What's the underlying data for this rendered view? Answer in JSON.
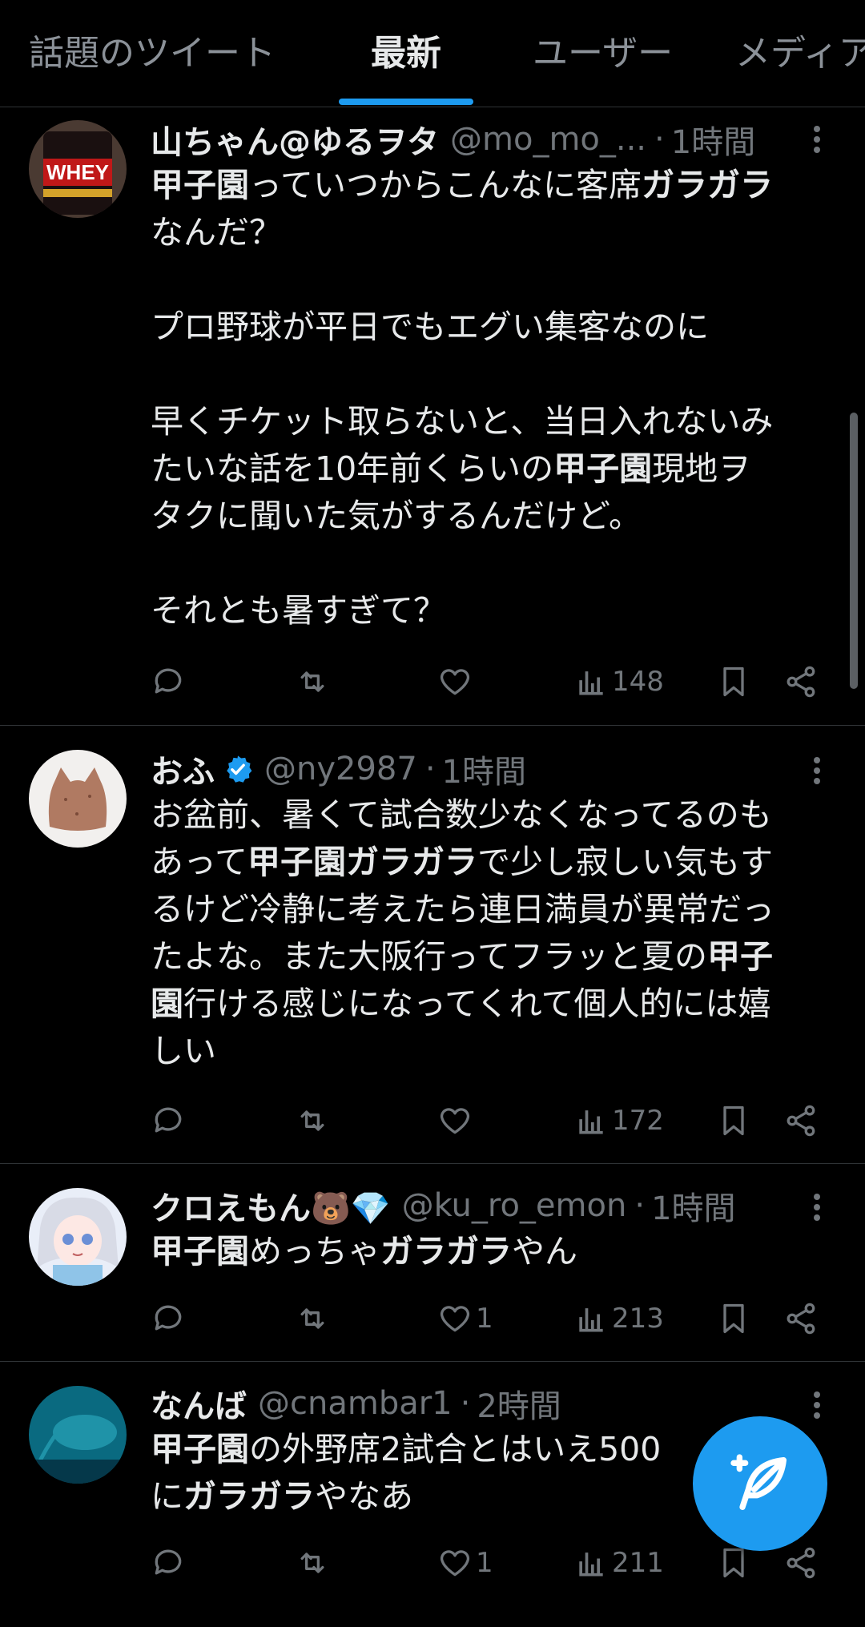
{
  "tabs": [
    {
      "label": "話題のツイート"
    },
    {
      "label": "最新"
    },
    {
      "label": "ユーザー"
    },
    {
      "label": "メディア"
    }
  ],
  "active_tab": "最新",
  "colors": {
    "accent": "#1d9bf0",
    "background": "#000000",
    "text": "#e7e9ea",
    "muted": "#71767b",
    "divider": "#2f3336"
  },
  "tweets": [
    {
      "name": "山ちゃん@ゆるヲタ",
      "handle": "@mo_mo_...",
      "time": "1時間",
      "body_html": "<b>甲子園</b>っていつからこんなに客席<b>ガラガラ</b>\nなんだ？\n\nプロ野球が平日でもエグい集客なのに\n\n早くチケット取らないと、当日入れないみ\nたいな話を10年前くらいの<b>甲子園</b>現地ヲ\nタクに聞いた気がするんだけど。\n\nそれとも暑すぎて？",
      "likes": "",
      "views": "148",
      "avatar_icon": "whey-protein-avatar"
    },
    {
      "name": "おふ",
      "handle": "@ny2987",
      "time": "1時間",
      "verified": true,
      "body_html": "お盆前、暑くて試合数少なくなってるのも\nあって<b>甲子園ガラガラ</b>で少し寂しい気もす\nるけど冷静に考えたら連日満員が異常だっ\nたよな。また大阪行ってフラッと夏の<b>甲子\n園</b>行ける感じになってくれて個人的には嬉\nしい",
      "likes": "",
      "views": "172",
      "avatar_icon": "cat-bread-avatar"
    },
    {
      "name": "クロえもん🐻💎",
      "handle": "@ku_ro_emon",
      "time": "1時間",
      "body_html": "<b>甲子園</b>めっちゃ<b>ガラガラ</b>やん",
      "likes": "1",
      "views": "213",
      "avatar_icon": "anime-girl-avatar"
    },
    {
      "name": "なんば",
      "handle": "@cnambar1",
      "time": "2時間",
      "body_html": "<b>甲子園</b>の外野席2試合とはいえ500\nに<b>ガラガラ</b>やなあ",
      "likes": "1",
      "views": "211",
      "avatar_icon": "ocean-ray-avatar"
    }
  ],
  "separator": "·",
  "fab": {
    "icon": "compose-tweet-icon"
  }
}
